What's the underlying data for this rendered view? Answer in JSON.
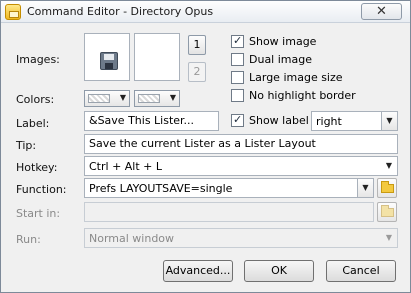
{
  "window": {
    "title": "Command Editor - Directory Opus",
    "close_glyph": "✕"
  },
  "images": {
    "label": "Images:",
    "button_1": "1",
    "button_2": "2"
  },
  "colors": {
    "label": "Colors:",
    "arrow": "▼"
  },
  "options": {
    "show_image": {
      "label": "Show image",
      "checked": true
    },
    "dual_image": {
      "label": "Dual image",
      "checked": false
    },
    "large_image_size": {
      "label": "Large image size",
      "checked": false
    },
    "no_highlight_border": {
      "label": "No highlight border",
      "checked": false
    }
  },
  "label_row": {
    "label": "Label:",
    "value": "&Save This Lister...",
    "show_label": {
      "label": "Show label",
      "checked": true
    },
    "position": "right",
    "arrow": "▼"
  },
  "tip": {
    "label": "Tip:",
    "value": "Save the current Lister as a Lister Layout"
  },
  "hotkey": {
    "label": "Hotkey:",
    "value": "Ctrl + Alt + L",
    "arrow": "▼"
  },
  "function": {
    "label": "Function:",
    "value": "Prefs LAYOUTSAVE=single",
    "arrow": "▼"
  },
  "start_in": {
    "label": "Start in:",
    "value": ""
  },
  "run": {
    "label": "Run:",
    "value": "Normal window",
    "arrow": "▼"
  },
  "buttons": {
    "advanced": "Advanced...",
    "ok": "OK",
    "cancel": "Cancel"
  }
}
